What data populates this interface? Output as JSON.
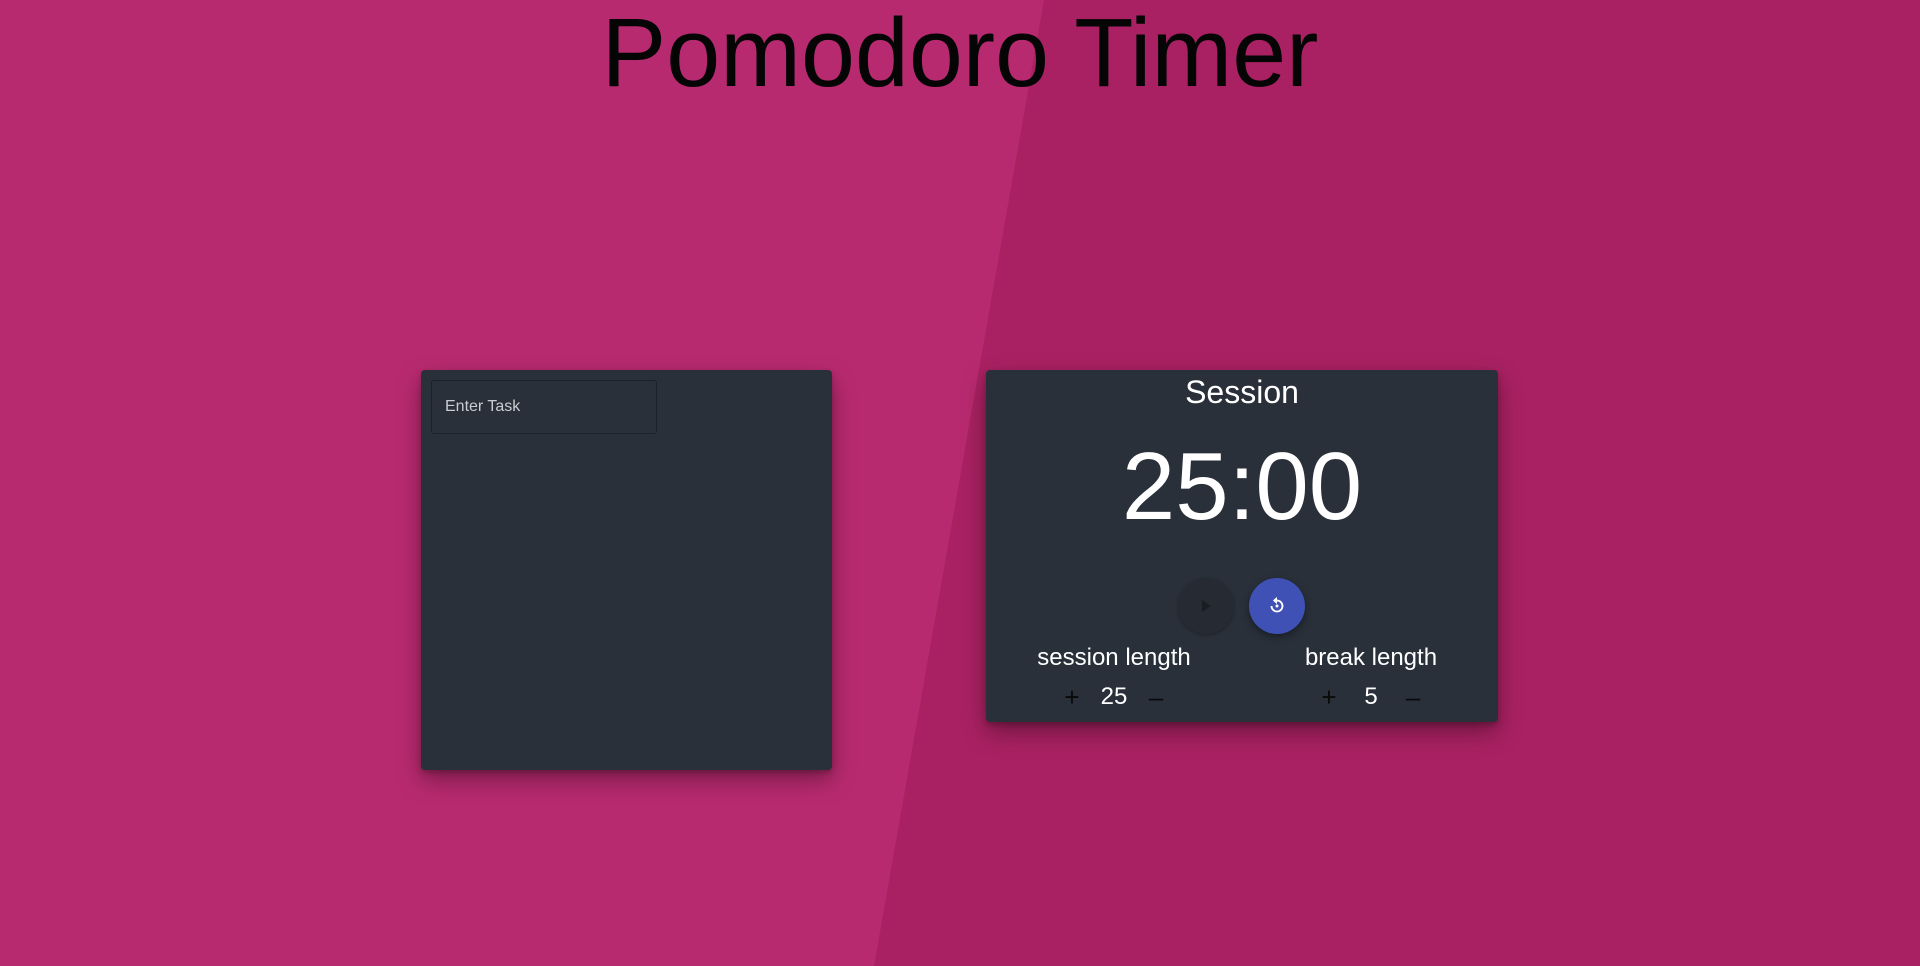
{
  "header": {
    "title": "Pomodoro Timer"
  },
  "tasks": {
    "input_placeholder": "Enter Task",
    "input_value": ""
  },
  "timer": {
    "mode": "Session",
    "time": "25:00",
    "play_icon": "play-icon",
    "reset_icon": "replay-icon",
    "session": {
      "label": "session length",
      "value": "25",
      "increment": "+",
      "decrement": "–"
    },
    "break": {
      "label": "break length",
      "value": "5",
      "increment": "+",
      "decrement": "–"
    }
  },
  "colors": {
    "background": "#b82a6f",
    "background_shade": "#a92162",
    "card": "#29303a",
    "accent": "#3f51b5"
  }
}
